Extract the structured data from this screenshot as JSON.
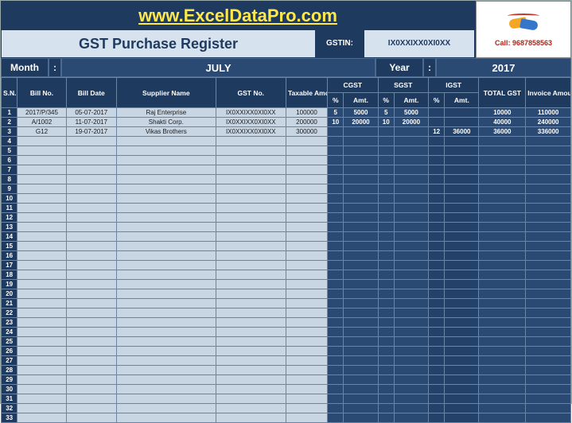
{
  "site_url": "www.ExcelDataPro.com",
  "title": "GST Purchase Register",
  "gstin_label": "GSTIN:",
  "gstin_value": "IX0XXIXX0XI0XX",
  "logo_call": "Call: 9687858563",
  "period": {
    "month_label": "Month",
    "colon": ":",
    "month_value": "JULY",
    "year_label": "Year",
    "year_value": "2017"
  },
  "headers": {
    "sn": "S.N.",
    "billno": "Bill No.",
    "billdate": "Bill Date",
    "supplier": "Supplier Name",
    "gstno": "GST No.",
    "taxable": "Taxable Amount",
    "cgst": "CGST",
    "sgst": "SGST",
    "igst": "IGST",
    "pct": "%",
    "amt": "Amt.",
    "totalgst": "TOTAL GST",
    "invoice": "Invoice Amount"
  },
  "rows": [
    {
      "sn": "1",
      "billno": "2017/P/345",
      "billdate": "05-07-2017",
      "supplier": "Raj Enterprise",
      "gstno": "IX0XXIXX0XI0XX",
      "taxable": "100000",
      "cgst_p": "5",
      "cgst_a": "5000",
      "sgst_p": "5",
      "sgst_a": "5000",
      "igst_p": "",
      "igst_a": "",
      "total": "10000",
      "invoice": "110000"
    },
    {
      "sn": "2",
      "billno": "A/1002",
      "billdate": "11-07-2017",
      "supplier": "Shakti Corp.",
      "gstno": "IX0XXIXX0XI0XX",
      "taxable": "200000",
      "cgst_p": "10",
      "cgst_a": "20000",
      "sgst_p": "10",
      "sgst_a": "20000",
      "igst_p": "",
      "igst_a": "",
      "total": "40000",
      "invoice": "240000"
    },
    {
      "sn": "3",
      "billno": "G12",
      "billdate": "19-07-2017",
      "supplier": "Vikas Brothers",
      "gstno": "IX0XXIXX0XI0XX",
      "taxable": "300000",
      "cgst_p": "",
      "cgst_a": "",
      "sgst_p": "",
      "sgst_a": "",
      "igst_p": "12",
      "igst_a": "36000",
      "total": "36000",
      "invoice": "336000"
    },
    {
      "sn": "4"
    },
    {
      "sn": "5"
    },
    {
      "sn": "6"
    },
    {
      "sn": "7"
    },
    {
      "sn": "8"
    },
    {
      "sn": "9"
    },
    {
      "sn": "10"
    },
    {
      "sn": "11"
    },
    {
      "sn": "12"
    },
    {
      "sn": "13"
    },
    {
      "sn": "14"
    },
    {
      "sn": "15"
    },
    {
      "sn": "16"
    },
    {
      "sn": "17"
    },
    {
      "sn": "18"
    },
    {
      "sn": "19"
    },
    {
      "sn": "20"
    },
    {
      "sn": "21"
    },
    {
      "sn": "22"
    },
    {
      "sn": "23"
    },
    {
      "sn": "24"
    },
    {
      "sn": "25"
    },
    {
      "sn": "26"
    },
    {
      "sn": "27"
    },
    {
      "sn": "28"
    },
    {
      "sn": "29"
    },
    {
      "sn": "30"
    },
    {
      "sn": "31"
    },
    {
      "sn": "32"
    },
    {
      "sn": "33"
    }
  ]
}
